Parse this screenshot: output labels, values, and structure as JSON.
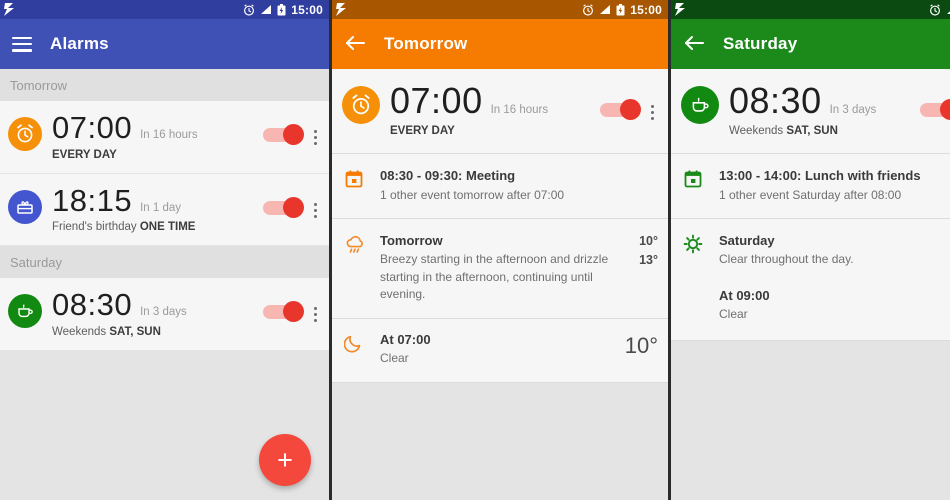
{
  "statusbar": {
    "time": "15:00",
    "icons": [
      "flash-icon",
      "alarm-icon",
      "signal-icon",
      "battery-icon"
    ]
  },
  "panel_alarms": {
    "appbar": {
      "menu_icon": "hamburger-icon",
      "title": "Alarms"
    },
    "groups": [
      {
        "label": "Tomorrow",
        "alarms": [
          {
            "icon": "alarm-clock-icon",
            "avatar_color": "#f59008",
            "time": "07:00",
            "when": "In 16 hours",
            "sub_prefix": "",
            "sub_bold": "EVERY DAY",
            "enabled": true
          },
          {
            "icon": "gift-icon",
            "avatar_color": "#4356cf",
            "time": "18:15",
            "when": "In 1 day",
            "sub_prefix": "Friend's birthday ",
            "sub_bold": "ONE TIME",
            "enabled": true
          }
        ]
      },
      {
        "label": "Saturday",
        "alarms": [
          {
            "icon": "coffee-cup-icon",
            "avatar_color": "#128a12",
            "time": "08:30",
            "when": "In 3 days",
            "sub_prefix": "Weekends ",
            "sub_bold": "SAT, SUN",
            "enabled": true
          }
        ]
      }
    ],
    "fab_label": "+"
  },
  "panel_tomorrow": {
    "appbar": {
      "back_icon": "back-arrow-icon",
      "title": "Tomorrow",
      "color": "#f57c00"
    },
    "alarm": {
      "icon": "alarm-clock-icon",
      "avatar_color": "#f59008",
      "time": "07:00",
      "when": "In 16 hours",
      "sub_bold": "EVERY DAY",
      "enabled": true
    },
    "cards": [
      {
        "icon": "calendar-icon",
        "icon_color": "#f57c00",
        "title": "08:30 - 09:30: Meeting",
        "subtitle": "1 other event tomorrow after 07:00",
        "temps": []
      },
      {
        "icon": "rain-cloud-icon",
        "icon_color": "#f08a2a",
        "title": "Tomorrow",
        "subtitle": "Breezy starting in the afternoon and drizzle starting in the afternoon, continuing until evening.",
        "temps": [
          "10°",
          "13°"
        ]
      },
      {
        "icon": "moon-icon",
        "icon_color": "#f08a2a",
        "title": "At 07:00",
        "subtitle": "Clear",
        "big_temp": "10°"
      }
    ]
  },
  "panel_saturday": {
    "appbar": {
      "back_icon": "back-arrow-icon",
      "title": "Saturday",
      "color": "#1b8a1b"
    },
    "alarm": {
      "icon": "coffee-cup-icon",
      "avatar_color": "#128a12",
      "time": "08:30",
      "when": "In 3 days",
      "sub_prefix": "Weekends ",
      "sub_bold": "SAT, SUN",
      "enabled": true
    },
    "cards": [
      {
        "icon": "calendar-icon",
        "icon_color": "#1b8a1b",
        "title": "13:00 - 14:00: Lunch with friends",
        "subtitle": "1 other event Saturday after 08:00"
      },
      {
        "icon": "sun-icon",
        "icon_color": "#1b8a1b",
        "title": "Saturday",
        "subtitle": "Clear throughout the day."
      },
      {
        "icon": "",
        "title": "At 09:00",
        "subtitle": "Clear"
      }
    ]
  },
  "colors": {
    "indigo": "#3f51b5",
    "orange": "#f57c00",
    "green": "#1b8a1b",
    "toggle_on": "#e8362c",
    "fab": "#f4483c"
  }
}
